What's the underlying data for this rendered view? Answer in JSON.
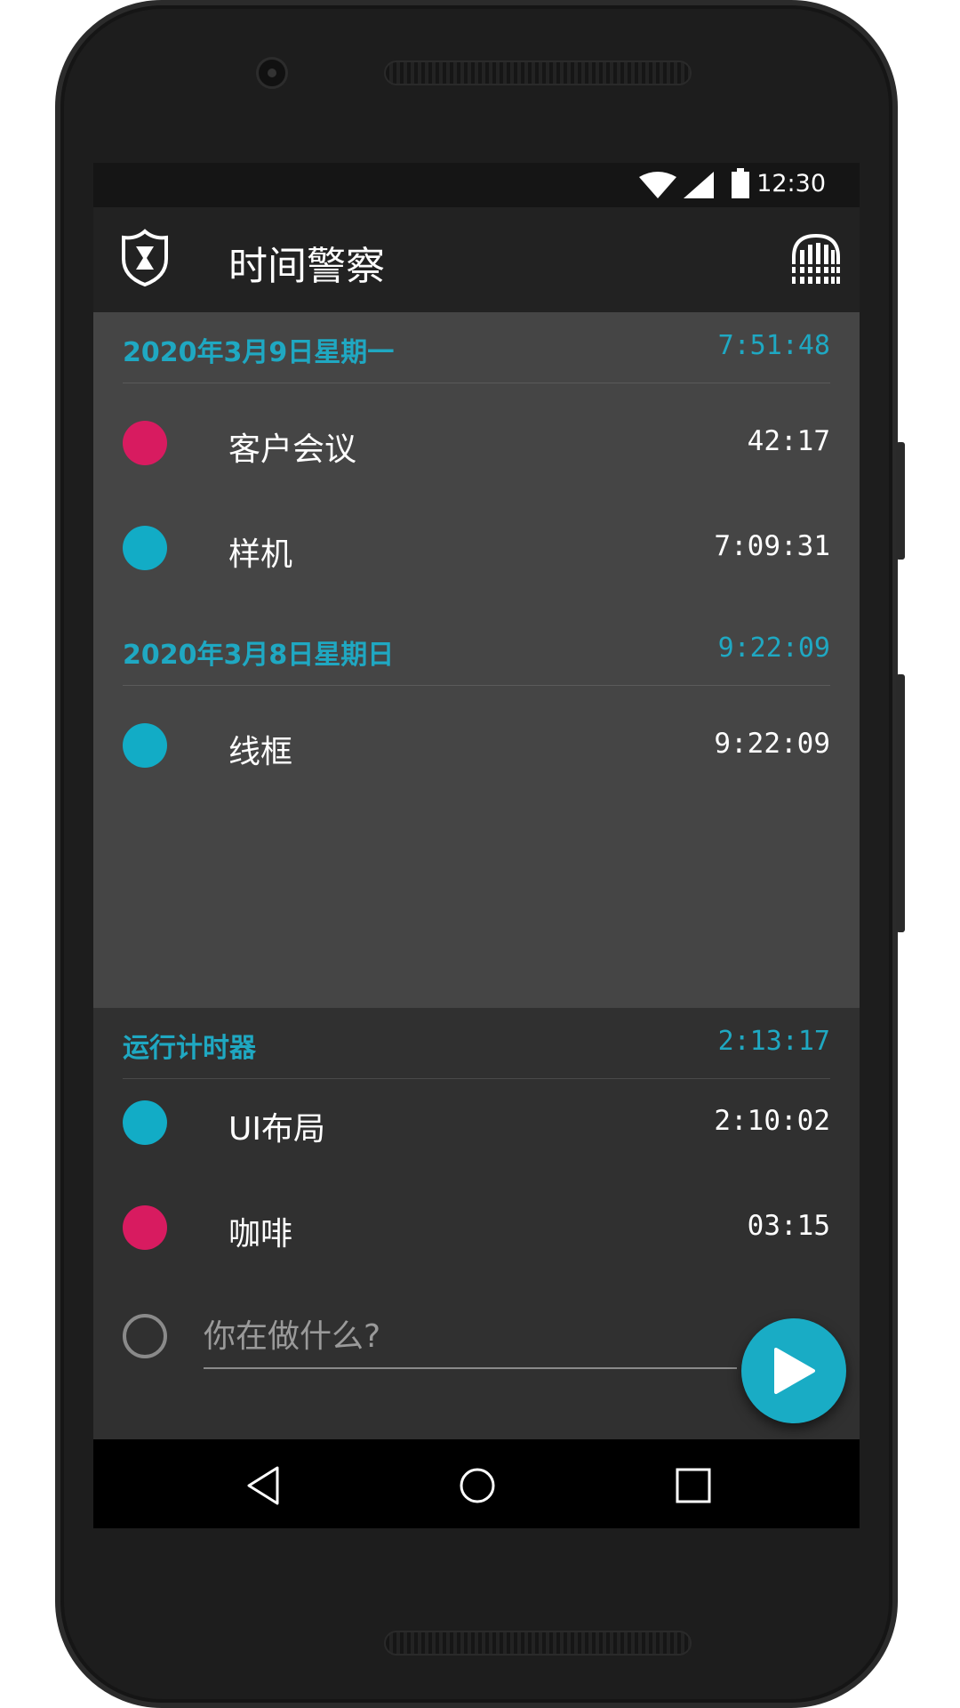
{
  "status_bar": {
    "time": "12:30",
    "icons": [
      "wifi-icon",
      "cell-signal-icon",
      "battery-icon"
    ]
  },
  "app_bar": {
    "title": "时间警察",
    "logo_icon": "police-badge-hourglass-icon",
    "action_icon": "timers-archive-icon"
  },
  "days": [
    {
      "date": "2020年3月9日星期一",
      "total": "7:51:48",
      "entries": [
        {
          "label": "客户会议",
          "duration": "42:17",
          "color": "#d81b60"
        },
        {
          "label": "样机",
          "duration": "7:09:31",
          "color": "#12acc6"
        }
      ]
    },
    {
      "date": "2020年3月8日星期日",
      "total": "9:22:09",
      "entries": [
        {
          "label": "线框",
          "duration": "9:22:09",
          "color": "#12acc6"
        }
      ]
    }
  ],
  "running": {
    "title": "运行计时器",
    "total": "2:13:17",
    "entries": [
      {
        "label": "UI布局",
        "duration": "2:10:02",
        "color": "#12acc6"
      },
      {
        "label": "咖啡",
        "duration": "03:15",
        "color": "#d81b60"
      }
    ]
  },
  "input": {
    "placeholder": "你在做什么?"
  },
  "fab": {
    "icon": "play-icon"
  },
  "nav": {
    "icons": [
      "back-icon",
      "home-icon",
      "recents-icon"
    ]
  },
  "colors": {
    "accent": "#1fa8c2",
    "pink": "#d81b60",
    "cyan": "#12acc6"
  }
}
